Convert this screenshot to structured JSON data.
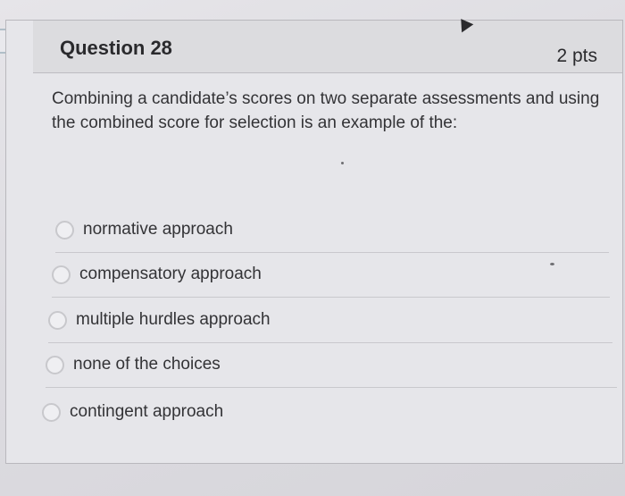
{
  "question": {
    "title": "Question 28",
    "points": "2 pts",
    "text": "Combining a candidate’s scores on two separate assessments and using the combined score for selection is an example of the:"
  },
  "answers": [
    {
      "label": "normative approach",
      "selected": false
    },
    {
      "label": "compensatory approach",
      "selected": false
    },
    {
      "label": "multiple hurdles approach",
      "selected": false
    },
    {
      "label": "none of the choices",
      "selected": false
    },
    {
      "label": "contingent approach",
      "selected": false
    }
  ],
  "colors": {
    "card_background": "#e6e6ea",
    "header_background": "#dcdcdf",
    "text": "#333336",
    "radio_border": "#c8c8cc"
  },
  "icons": {
    "cursor": "mouse-pointer-icon",
    "side_tab": "collapse-tab-icon"
  }
}
